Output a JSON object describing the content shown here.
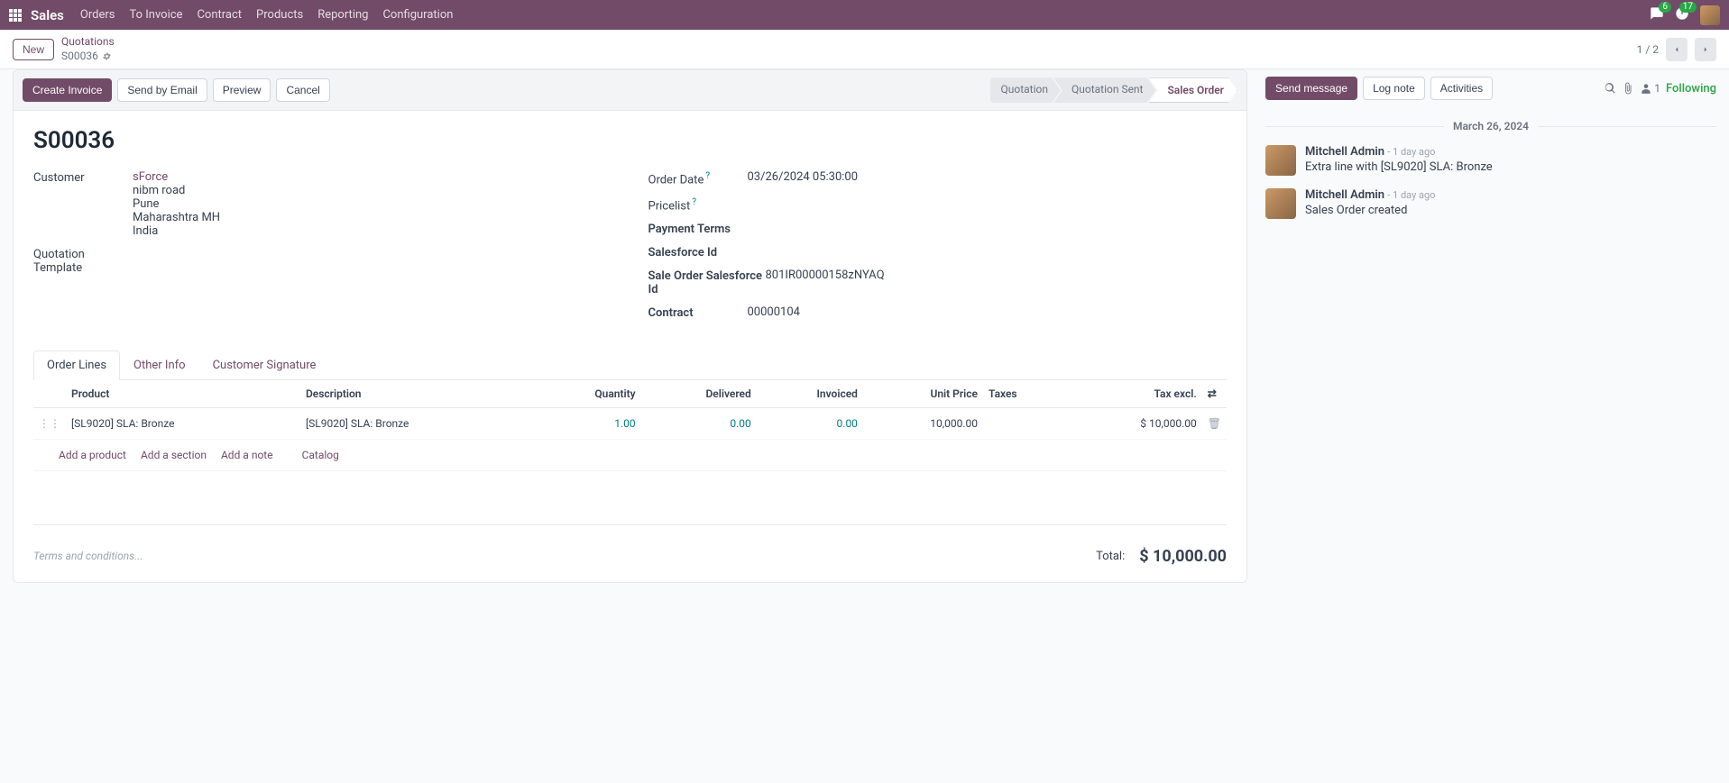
{
  "nav": {
    "brand": "Sales",
    "items": [
      "Orders",
      "To Invoice",
      "Contract",
      "Products",
      "Reporting",
      "Configuration"
    ],
    "badge_chat": "6",
    "badge_activity": "17"
  },
  "crumb": {
    "new_btn": "New",
    "path1": "Quotations",
    "path2": "S00036",
    "pager": "1 / 2"
  },
  "actions": {
    "create_invoice": "Create Invoice",
    "send_email": "Send by Email",
    "preview": "Preview",
    "cancel": "Cancel",
    "status": [
      "Quotation",
      "Quotation Sent",
      "Sales Order"
    ]
  },
  "record": {
    "title": "S00036",
    "customer_label": "Customer",
    "customer_link": "sForce",
    "customer_addr": [
      "nibm road",
      "Pune",
      "Maharashtra MH",
      "India"
    ],
    "quotation_template_label": "Quotation Template",
    "order_date_label": "Order Date",
    "order_date": "03/26/2024 05:30:00",
    "pricelist_label": "Pricelist",
    "payment_terms_label": "Payment Terms",
    "salesforce_id_label": "Salesforce Id",
    "so_sf_id_label": "Sale Order Salesforce Id",
    "so_sf_id": "801IR00000158zNYAQ",
    "contract_label": "Contract",
    "contract": "00000104"
  },
  "tabs": [
    "Order Lines",
    "Other Info",
    "Customer Signature"
  ],
  "table": {
    "headers": [
      "Product",
      "Description",
      "Quantity",
      "Delivered",
      "Invoiced",
      "Unit Price",
      "Taxes",
      "Tax excl."
    ],
    "row": {
      "product": "[SL9020] SLA: Bronze",
      "desc": "[SL9020] SLA: Bronze",
      "qty": "1.00",
      "delivered": "0.00",
      "invoiced": "0.00",
      "unit_price": "10,000.00",
      "taxes": "",
      "subtotal": "$ 10,000.00"
    },
    "add_product": "Add a product",
    "add_section": "Add a section",
    "add_note": "Add a note",
    "catalog": "Catalog"
  },
  "footer": {
    "terms_placeholder": "Terms and conditions...",
    "total_label": "Total:",
    "total_value": "$ 10,000.00"
  },
  "chatter": {
    "send_message": "Send message",
    "log_note": "Log note",
    "activities": "Activities",
    "follower_count": "1",
    "following": "Following",
    "date_header": "March 26, 2024",
    "messages": [
      {
        "author": "Mitchell Admin",
        "time": "- 1 day ago",
        "text": "Extra line with [SL9020] SLA: Bronze"
      },
      {
        "author": "Mitchell Admin",
        "time": "- 1 day ago",
        "text": "Sales Order created"
      }
    ]
  }
}
